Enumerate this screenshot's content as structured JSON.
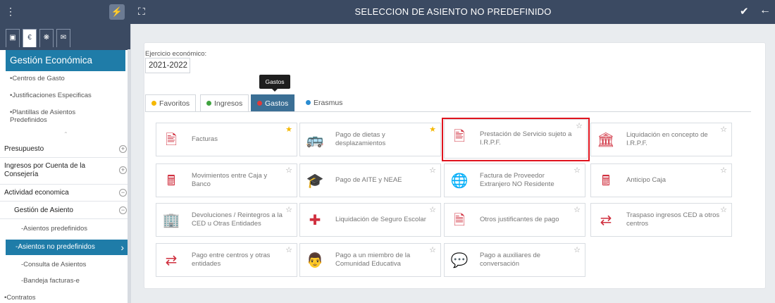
{
  "window": {
    "title": "SELECCION DE ASIENTO NO PREDEFINIDO"
  },
  "sidebar": {
    "section_title": "Gestión Económica",
    "items_top": [
      "•Centros de Gasto",
      "•Justificaciones Especificas",
      "•Plantillas de Asientos Predefinidos"
    ],
    "sections": [
      {
        "label": "Presupuesto",
        "sign": "+"
      },
      {
        "label": "Ingresos por Cuenta de la Consejería",
        "sign": "+"
      },
      {
        "label": "Actividad economica",
        "sign": "−"
      },
      {
        "label": "Gestión de Asiento",
        "sign": "−"
      }
    ],
    "sub_items": [
      "-Asientos predefinidos",
      "-Asientos no predefinidos",
      "-Consulta de Asientos",
      "-Bandeja facturas-e"
    ],
    "bottom_item": "•Contratos",
    "tab_icons": [
      "book-icon",
      "euro-icon",
      "settings-icon",
      "mail-icon"
    ]
  },
  "main": {
    "ejercicio_label": "Ejercicio económico:",
    "ejercicio_value": "2021-2022",
    "tooltip": "Gastos",
    "tabs": [
      {
        "label": "Favoritos",
        "dot_color": "#f5b800"
      },
      {
        "label": "Ingresos",
        "dot_color": "#3fa33f"
      },
      {
        "label": "Gastos",
        "dot_color": "#e03a3a"
      },
      {
        "label": "Erasmus",
        "dot_color": "#2a8cd1"
      }
    ],
    "tiles": [
      [
        "Facturas",
        "Pago de dietas y desplazamientos",
        "Prestación de Servicio sujeto a I.R.P.F.",
        "Liquidación en concepto de I.R.P.F."
      ],
      [
        "Movimientos entre Caja y Banco",
        "Pago de AITE y NEAE",
        "Factura de Proveedor Extranjero NO Residente",
        "Anticipo Caja"
      ],
      [
        "Devoluciones / Reintegros a la CED u Otras Entidades",
        "Liquidación de Seguro Escolar",
        "Otros justificantes de pago",
        "Traspaso ingresos CED a otros centros"
      ],
      [
        "Pago entre centros y otras entidades",
        "Pago a un miembro de la Comunidad Educativa",
        "Pago a auxiliares de conversación"
      ]
    ]
  }
}
